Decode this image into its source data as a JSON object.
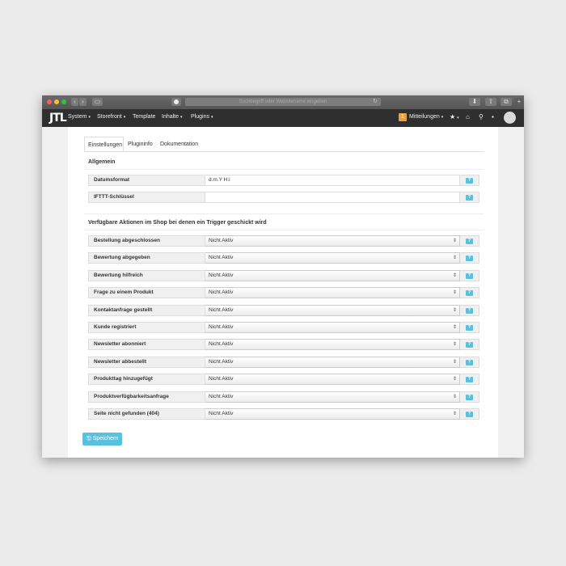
{
  "browser": {
    "url_placeholder": "Suchbegriff oder Websitename eingeben",
    "back_icon": "chevron-left-icon",
    "forward_icon": "chevron-right-icon"
  },
  "nav": {
    "logo": "JTL",
    "items": [
      {
        "label": "System",
        "caret": "▾"
      },
      {
        "label": "Storefront",
        "caret": "▾"
      },
      {
        "label": "Template",
        "caret": ""
      },
      {
        "label": "Inhalte",
        "caret": "▾"
      },
      {
        "label": "Plugins",
        "caret": "▾"
      }
    ],
    "messages_count": "1",
    "messages_label": "Mitteilungen"
  },
  "tabs": [
    "Einstellungen",
    "Plugininfo",
    "Dokumentation"
  ],
  "general": {
    "title": "Allgemein",
    "rows": [
      {
        "label": "Datumsformat",
        "value": "d.m.Y H:i"
      },
      {
        "label": "IFTTT-Schlüssel",
        "value": ""
      }
    ]
  },
  "actions": {
    "title": "Verfügbare Aktionen im Shop bei denen ein Trigger geschickt wird",
    "rows": [
      {
        "label": "Bestellung abgeschlossen",
        "value": "Nicht Aktiv"
      },
      {
        "label": "Bewertung abgegeben",
        "value": "Nicht Aktiv"
      },
      {
        "label": "Bewertung hilfreich",
        "value": "Nicht Aktiv"
      },
      {
        "label": "Frage zu einem Produkt",
        "value": "Nicht Aktiv"
      },
      {
        "label": "Kontaktanfrage gestellt",
        "value": "Nicht Aktiv"
      },
      {
        "label": "Kunde registriert",
        "value": "Nicht Aktiv"
      },
      {
        "label": "Newsletter abonniert",
        "value": "Nicht Aktiv"
      },
      {
        "label": "Newsletter abbestellt",
        "value": "Nicht Aktiv"
      },
      {
        "label": "Produkttag hinzugefügt",
        "value": "Nicht Aktiv"
      },
      {
        "label": "Produktverfügbarkeitsanfrage",
        "value": "Nicht Aktiv"
      },
      {
        "label": "Seite nicht gefunden (404)",
        "value": "Nicht Aktiv"
      }
    ]
  },
  "help_label": "?",
  "save_label": "Speichern",
  "colors": {
    "accent": "#5bc0de",
    "navbar": "#2f2f2f",
    "badge": "#e8a43a"
  }
}
